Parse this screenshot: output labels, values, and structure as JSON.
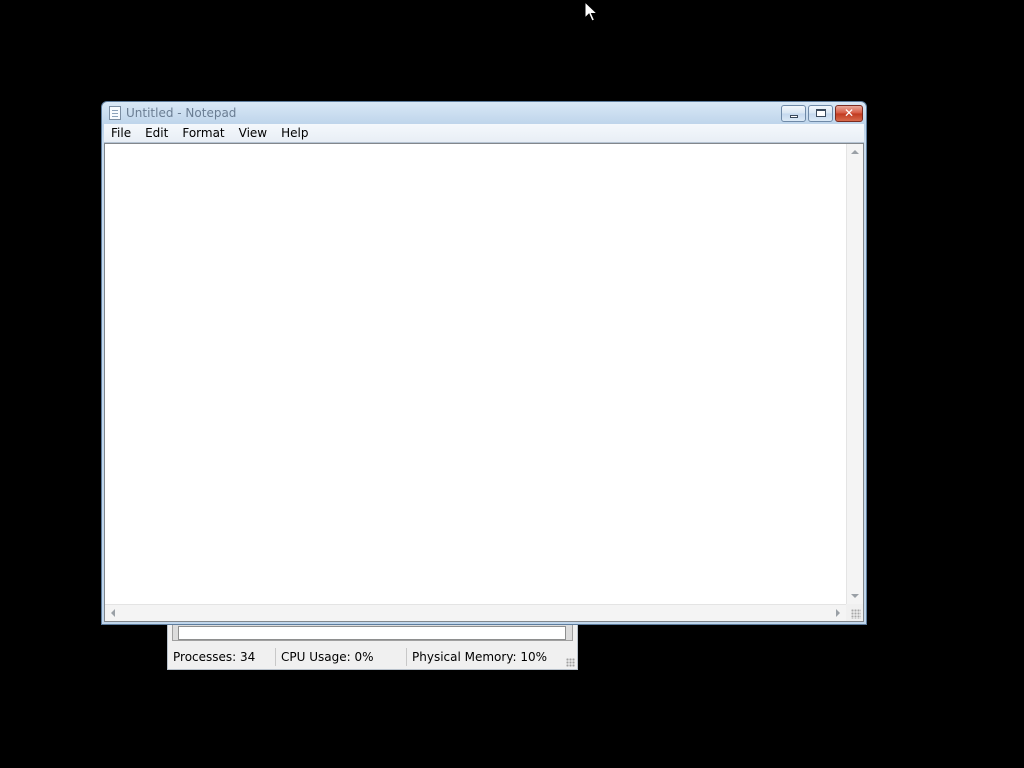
{
  "notepad": {
    "title": "Untitled - Notepad",
    "menu": [
      "File",
      "Edit",
      "Format",
      "View",
      "Help"
    ],
    "content": "",
    "icon": "notepad-icon"
  },
  "task_manager": {
    "status": {
      "processes": "Processes: 34",
      "cpu": "CPU Usage: 0%",
      "memory": "Physical Memory: 10%"
    }
  },
  "colors": {
    "desktop_background": "#000000",
    "close_button": "#c9442b"
  }
}
